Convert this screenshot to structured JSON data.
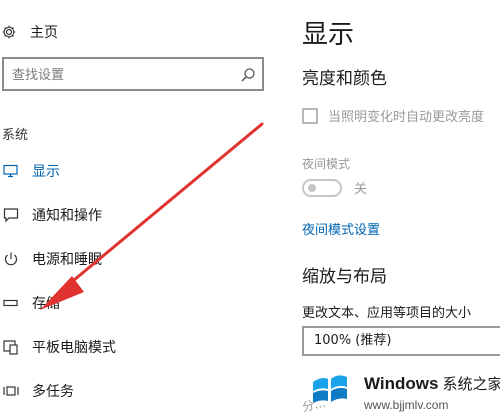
{
  "sidebar": {
    "home_label": "主页",
    "search_placeholder": "查找设置",
    "section_label": "系统",
    "items": [
      {
        "label": "显示",
        "icon": "monitor-icon",
        "active": true
      },
      {
        "label": "通知和操作",
        "icon": "notification-icon"
      },
      {
        "label": "电源和睡眠",
        "icon": "power-icon"
      },
      {
        "label": "存储",
        "icon": "storage-icon"
      },
      {
        "label": "平板电脑模式",
        "icon": "tablet-mode-icon"
      },
      {
        "label": "多任务",
        "icon": "multitask-icon"
      }
    ]
  },
  "main": {
    "title": "显示",
    "brightness_heading": "亮度和颜色",
    "auto_brightness_label": "当照明变化时自动更改亮度",
    "night_mode_label": "夜间模式",
    "night_toggle_state": "关",
    "night_settings_link": "夜间模式设置",
    "scale_heading": "缩放与布局",
    "scale_field_label": "更改文本、应用等项目的大小",
    "scale_value": "100% (推荐)",
    "partial_text": "分..."
  },
  "watermark": {
    "brand": "Windows",
    "brand_cn": "系统之家",
    "url": "www.bjjmlv.com"
  },
  "colors": {
    "accent": "#0063b1",
    "arrow": "#e0322f"
  }
}
